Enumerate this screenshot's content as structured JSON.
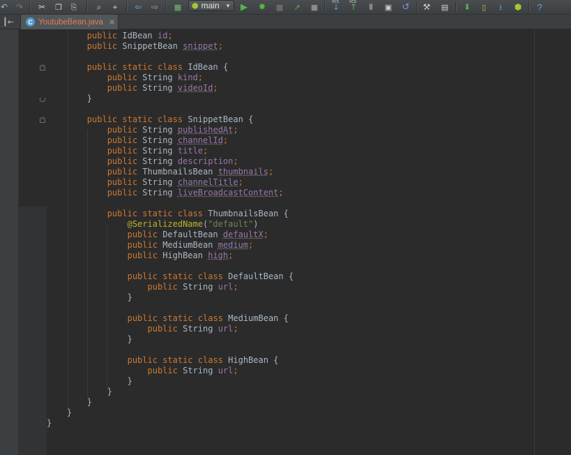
{
  "toolbar": {
    "run_config": "main",
    "icons": [
      "undo-icon",
      "redo-icon",
      "cut-icon",
      "copy-icon",
      "paste-icon",
      "find-icon",
      "replace-icon",
      "back-icon",
      "forward-icon",
      "make-project-icon",
      "run-config-dropdown",
      "run-icon",
      "debug-icon",
      "coverage-icon",
      "attach-debugger-icon",
      "stop-icon",
      "vcs-update-icon",
      "vcs-commit-icon",
      "vcs-compare-icon",
      "vcs-revert-icon",
      "settings-icon",
      "project-structure-icon",
      "sync-gradle-icon",
      "avd-manager-icon",
      "sdk-manager-icon",
      "android-monitor-icon",
      "help-icon"
    ],
    "vcs_label": "VCS",
    "help_label": "?"
  },
  "tabs": [
    {
      "label": "YoutubeBean.java",
      "icon": "java-class-icon",
      "icon_letter": "C",
      "close": "×",
      "active": true
    }
  ],
  "colors": {
    "keyword": "#cc7832",
    "field": "#9876aa",
    "annotation": "#bbb529",
    "string": "#6a8759",
    "text": "#a9b7c6",
    "background": "#2b2b2b",
    "tab_file": "#e37b5b"
  },
  "code_lines": [
    "        public IdBean id;",
    "        public SnippetBean snippet;",
    "",
    "        public static class IdBean {",
    "            public String kind;",
    "            public String videoId;",
    "        }",
    "",
    "        public static class SnippetBean {",
    "            public String publishedAt;",
    "            public String channelId;",
    "            public String title;",
    "            public String description;",
    "            public ThumbnailsBean thumbnails;",
    "            public String channelTitle;",
    "            public String liveBroadcastContent;",
    "",
    "            public static class ThumbnailsBean {",
    "                @SerializedName(\"default\")",
    "                public DefaultBean defaultX;",
    "                public MediumBean medium;",
    "                public HighBean high;",
    "",
    "                public static class DefaultBean {",
    "                    public String url;",
    "                }",
    "",
    "                public static class MediumBean {",
    "                    public String url;",
    "                }",
    "",
    "                public static class HighBean {",
    "                    public String url;",
    "                }",
    "            }",
    "        }",
    "    }",
    "}"
  ]
}
